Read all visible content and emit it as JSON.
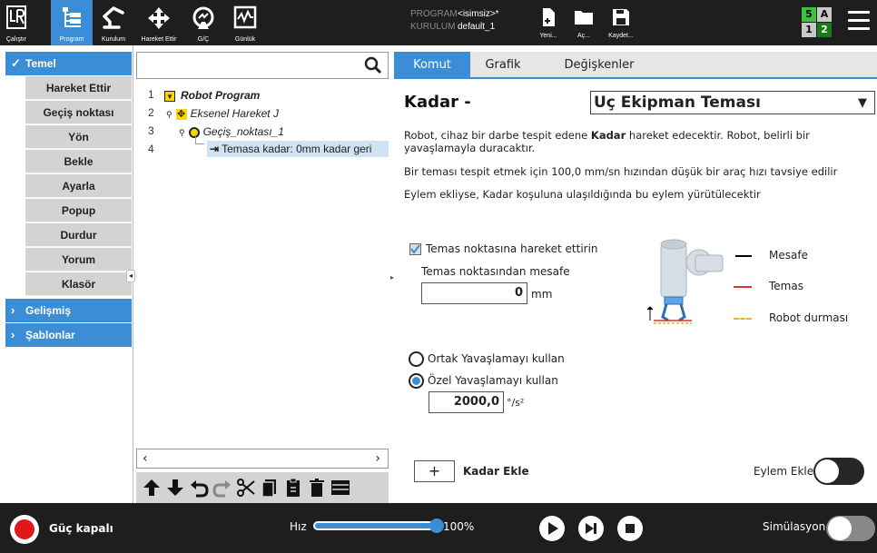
{
  "topbar": {
    "nav": [
      {
        "label": "Çalıştır",
        "icon": "ur-logo-icon"
      },
      {
        "label": "Program",
        "icon": "program-icon",
        "active": true
      },
      {
        "label": "Kurulum",
        "icon": "robot-arm-icon"
      },
      {
        "label": "Hareket Ettir",
        "icon": "move-arrows-icon"
      },
      {
        "label": "G/Ç",
        "icon": "io-icon"
      },
      {
        "label": "Günlük",
        "icon": "log-icon"
      }
    ],
    "program_key": "PROGRAM",
    "program_value": "<isimsiz>*",
    "installation_key": "KURULUM",
    "installation_value": "default_1",
    "file_buttons": [
      {
        "label": "Yeni...",
        "icon": "new-file-icon"
      },
      {
        "label": "Aç...",
        "icon": "folder-icon"
      },
      {
        "label": "Kaydet...",
        "icon": "save-icon"
      }
    ],
    "status": {
      "tl": "5",
      "tr": "A",
      "bl": "1",
      "br": "2"
    },
    "colors": {
      "green": "#3cc43c",
      "gray": "#c8c8c8",
      "dark_green": "#1a7a1a"
    }
  },
  "sidebar": {
    "basic": {
      "label": "Temel",
      "expanded": true
    },
    "commands": [
      "Hareket Ettir",
      "Geçiş noktası",
      "Yön",
      "Bekle",
      "Ayarla",
      "Popup",
      "Durdur",
      "Yorum",
      "Klasör"
    ],
    "advanced": {
      "label": "Gelişmiş"
    },
    "templates": {
      "label": "Şablonlar"
    }
  },
  "tree": {
    "rows": [
      {
        "num": "1",
        "text": "Robot Program"
      },
      {
        "num": "2",
        "text": "Eksenel Hareket J"
      },
      {
        "num": "3",
        "text": "Geçiş_noktası_1"
      },
      {
        "num": "4",
        "text": "Temasa kadar: 0mm kadar geri"
      }
    ]
  },
  "tabs": [
    "Komut",
    "Grafik",
    "Değişkenler"
  ],
  "command": {
    "title": "Kadar -",
    "type_selected": "Uç Ekipman Teması",
    "desc1_a": "Robot, cihaz bir darbe tespit edene ",
    "desc1_bold": "Kadar",
    "desc1_b": " hareket edecektir. Robot, belirli bir yavaşlamayla duracaktır.",
    "desc2": "Bir teması tespit etmek için 100,0 mm/sn hızından düşük bir araç hızı tavsiye edilir",
    "desc3": "Eylem ekliyse, Kadar koşuluna ulaşıldığında bu eylem yürütülecektir",
    "move_to_contact_label": "Temas noktasına hareket ettirin",
    "move_to_contact_checked": true,
    "distance_label": "Temas noktasından mesafe",
    "distance_value": "0",
    "distance_unit": "mm",
    "legend": [
      {
        "label": "Mesafe",
        "color": "#000000"
      },
      {
        "label": "Temas",
        "color": "#e03030"
      },
      {
        "label": "Robot durması",
        "color": "#f0b030"
      }
    ],
    "radio_shared": "Ortak Yavaşlamayı kullan",
    "radio_custom": "Özel Yavaşlamayı kullan",
    "custom_selected": true,
    "decel_value": "2000,0",
    "decel_unit": "°/s²",
    "add_until_label": "Kadar Ekle",
    "add_action_label": "Eylem Ekle",
    "add_action_on": false
  },
  "bottom": {
    "power_label": "Güç kapalı",
    "speed_label": "Hız",
    "speed_value": "100%",
    "speed_fraction": 1.0,
    "simulation_label": "Simülasyon",
    "simulation_on": true
  }
}
